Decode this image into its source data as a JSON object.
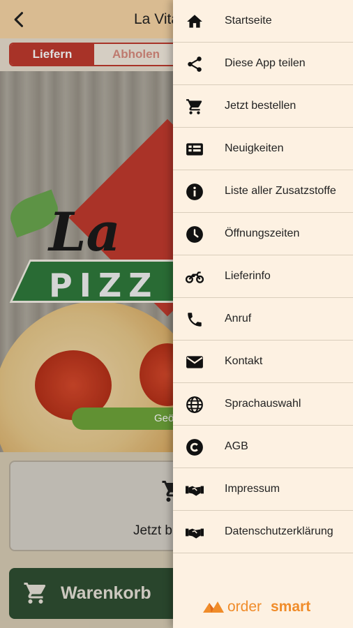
{
  "header": {
    "title": "La Vita",
    "back_icon": "back-arrow-icon"
  },
  "order_mode": {
    "active": "Liefern",
    "inactive": "Abholen"
  },
  "hero": {
    "logo_script": "La",
    "logo_band": "PIZZ",
    "green_button": "Geö"
  },
  "cart_card": {
    "text": "Jetzt b",
    "icon": "cart-icon"
  },
  "cart_button": {
    "label": "Warenkorb",
    "icon": "cart-icon"
  },
  "drawer": {
    "items": [
      {
        "label": "Startseite",
        "icon": "home-icon"
      },
      {
        "label": "Diese App teilen",
        "icon": "share-icon"
      },
      {
        "label": "Jetzt bestellen",
        "icon": "cart-icon"
      },
      {
        "label": "Neuigkeiten",
        "icon": "news-icon"
      },
      {
        "label": "Liste aller Zusatzstoffe",
        "icon": "info-icon"
      },
      {
        "label": "Öffnungszeiten",
        "icon": "clock-icon"
      },
      {
        "label": "Lieferinfo",
        "icon": "motorbike-icon"
      },
      {
        "label": "Anruf",
        "icon": "phone-icon"
      },
      {
        "label": "Kontakt",
        "icon": "mail-icon"
      },
      {
        "label": "Sprachauswahl",
        "icon": "globe-icon"
      },
      {
        "label": "AGB",
        "icon": "copyright-icon"
      },
      {
        "label": "Impressum",
        "icon": "handshake-icon"
      },
      {
        "label": "Datenschutzerklärung",
        "icon": "handshake-icon"
      }
    ],
    "brand": {
      "word1": "order",
      "word2": "smart"
    }
  },
  "colors": {
    "accent_red": "#c03b2e",
    "drawer_bg": "#fdf1e2",
    "cart_green": "#2f4f33",
    "brand_orange": "#f08c2a"
  }
}
